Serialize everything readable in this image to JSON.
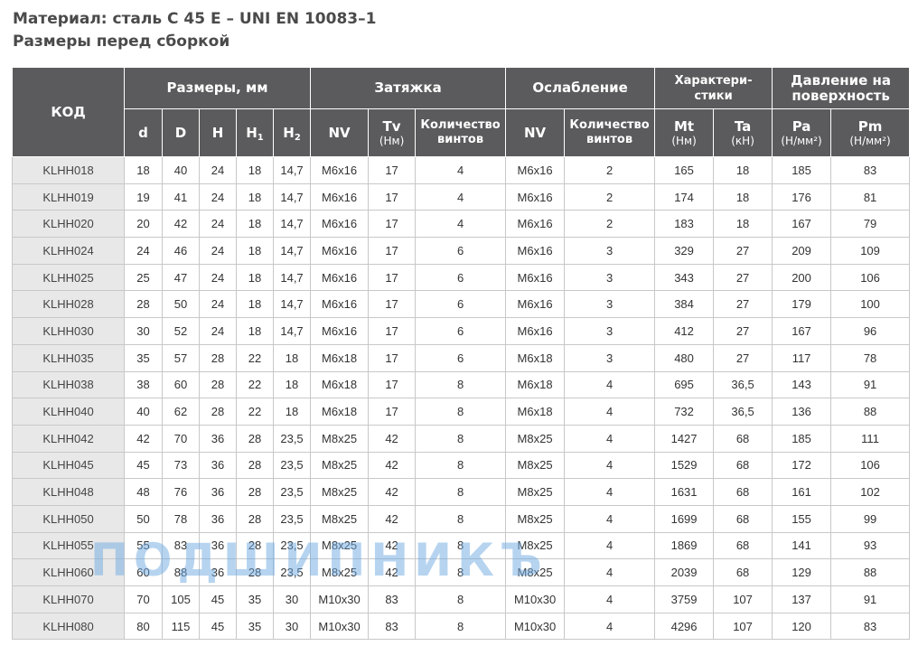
{
  "title": "Материал: сталь C 45 E – UNI EN 10083–1",
  "subtitle": "Размеры перед сборкой",
  "headers": {
    "code": "КОД",
    "sizes": "Размеры, мм",
    "tightening": "Затяжка",
    "loosening": "Ослабление",
    "characteristics": "Характери-стики",
    "pressure": "Давление на поверхность",
    "d": "d",
    "D": "D",
    "H": "H",
    "H1": "H",
    "H1_sub": "1",
    "H2": "H",
    "H2_sub": "2",
    "nv_tight": "NV",
    "tv": "Tv",
    "tv_unit": "(Нм)",
    "screws_tight": "Количество винтов",
    "nv_loose": "NV",
    "screws_loose": "Количество винтов",
    "mt": "Mt",
    "mt_unit": "(Нм)",
    "ta": "Ta",
    "ta_unit": "(кН)",
    "pa": "Pa",
    "pa_unit": "(Н/мм²)",
    "pm": "Pm",
    "pm_unit": "(Н/мм²)"
  },
  "rows": [
    [
      "KLHH018",
      "18",
      "40",
      "24",
      "18",
      "14,7",
      "M6x16",
      "17",
      "4",
      "M6x16",
      "2",
      "165",
      "18",
      "185",
      "83"
    ],
    [
      "KLHH019",
      "19",
      "41",
      "24",
      "18",
      "14,7",
      "M6x16",
      "17",
      "4",
      "M6x16",
      "2",
      "174",
      "18",
      "176",
      "81"
    ],
    [
      "KLHH020",
      "20",
      "42",
      "24",
      "18",
      "14,7",
      "M6x16",
      "17",
      "4",
      "M6x16",
      "2",
      "183",
      "18",
      "167",
      "79"
    ],
    [
      "KLHH024",
      "24",
      "46",
      "24",
      "18",
      "14,7",
      "M6x16",
      "17",
      "6",
      "M6x16",
      "3",
      "329",
      "27",
      "209",
      "109"
    ],
    [
      "KLHH025",
      "25",
      "47",
      "24",
      "18",
      "14,7",
      "M6x16",
      "17",
      "6",
      "M6x16",
      "3",
      "343",
      "27",
      "200",
      "106"
    ],
    [
      "KLHH028",
      "28",
      "50",
      "24",
      "18",
      "14,7",
      "M6x16",
      "17",
      "6",
      "M6x16",
      "3",
      "384",
      "27",
      "179",
      "100"
    ],
    [
      "KLHH030",
      "30",
      "52",
      "24",
      "18",
      "14,7",
      "M6x16",
      "17",
      "6",
      "M6x16",
      "3",
      "412",
      "27",
      "167",
      "96"
    ],
    [
      "KLHH035",
      "35",
      "57",
      "28",
      "22",
      "18",
      "M6x18",
      "17",
      "6",
      "M6x18",
      "3",
      "480",
      "27",
      "117",
      "78"
    ],
    [
      "KLHH038",
      "38",
      "60",
      "28",
      "22",
      "18",
      "M6x18",
      "17",
      "8",
      "M6x18",
      "4",
      "695",
      "36,5",
      "143",
      "91"
    ],
    [
      "KLHH040",
      "40",
      "62",
      "28",
      "22",
      "18",
      "M6x18",
      "17",
      "8",
      "M6x18",
      "4",
      "732",
      "36,5",
      "136",
      "88"
    ],
    [
      "KLHH042",
      "42",
      "70",
      "36",
      "28",
      "23,5",
      "M8x25",
      "42",
      "8",
      "M8x25",
      "4",
      "1427",
      "68",
      "185",
      "111"
    ],
    [
      "KLHH045",
      "45",
      "73",
      "36",
      "28",
      "23,5",
      "M8x25",
      "42",
      "8",
      "M8x25",
      "4",
      "1529",
      "68",
      "172",
      "106"
    ],
    [
      "KLHH048",
      "48",
      "76",
      "36",
      "28",
      "23,5",
      "M8x25",
      "42",
      "8",
      "M8x25",
      "4",
      "1631",
      "68",
      "161",
      "102"
    ],
    [
      "KLHH050",
      "50",
      "78",
      "36",
      "28",
      "23,5",
      "M8x25",
      "42",
      "8",
      "M8x25",
      "4",
      "1699",
      "68",
      "155",
      "99"
    ],
    [
      "KLHH055",
      "55",
      "83",
      "36",
      "28",
      "23,5",
      "M8x25",
      "42",
      "8",
      "M8x25",
      "4",
      "1869",
      "68",
      "141",
      "93"
    ],
    [
      "KLHH060",
      "60",
      "88",
      "36",
      "28",
      "23,5",
      "M8x25",
      "42",
      "8",
      "M8x25",
      "4",
      "2039",
      "68",
      "129",
      "88"
    ],
    [
      "KLHH070",
      "70",
      "105",
      "45",
      "35",
      "30",
      "M10x30",
      "83",
      "8",
      "M10x30",
      "4",
      "3759",
      "107",
      "137",
      "91"
    ],
    [
      "KLHH080",
      "80",
      "115",
      "45",
      "35",
      "30",
      "M10x30",
      "83",
      "8",
      "M10x30",
      "4",
      "4296",
      "107",
      "120",
      "83"
    ]
  ],
  "watermark": "ПОДШИПНИКЪ"
}
